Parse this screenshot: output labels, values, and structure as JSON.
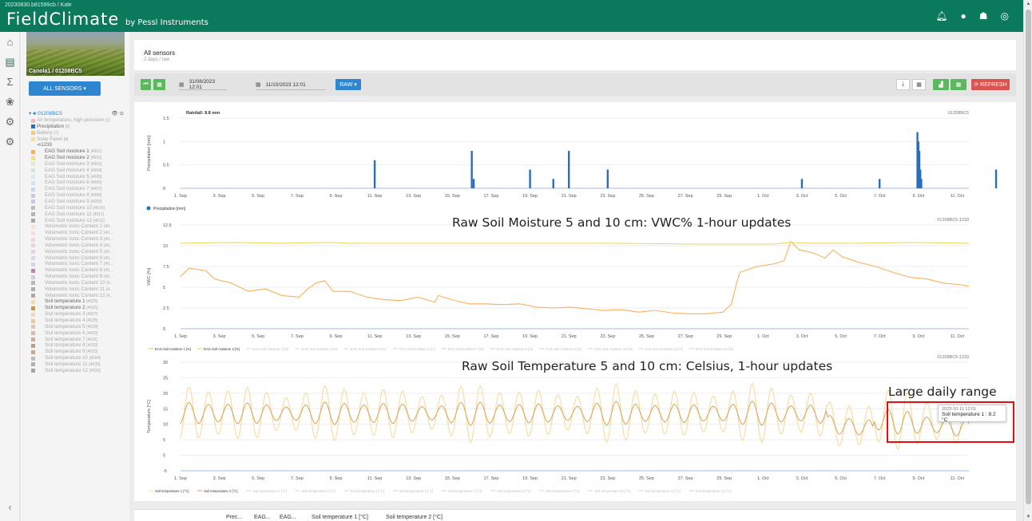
{
  "topbar": {
    "station_id": "20230830.b81599cb / Kale",
    "brand": "FieldClimate",
    "brand_suffix": "by Pessl Instruments",
    "icons": [
      "bell-icon",
      "user-icon",
      "farm-icon",
      "wifi-icon"
    ]
  },
  "rail": {
    "icons": [
      "home-icon",
      "chart-icon",
      "sum-icon",
      "plant-icon",
      "machine-icon",
      "settings-icon"
    ],
    "collapse": "‹"
  },
  "sidebar": {
    "station_label": "Canola1 / 01208BC5",
    "all_sensors_button": "ALL SENSORS ▾",
    "tree_root": "01208BC5",
    "items": [
      {
        "label": "Air temperature, high precision",
        "count": "[1]",
        "color": "#f4b6b6",
        "level": "sub",
        "dim": true
      },
      {
        "label": "Precipitation",
        "count": "[6]",
        "color": "#2a6ebb",
        "level": "sub",
        "dim": false
      },
      {
        "label": "Battery",
        "count": "[7]",
        "color": "#f4c98a",
        "level": "sub",
        "dim": true
      },
      {
        "label": "Solar Panel",
        "count": "[4]",
        "color": "#f6dca5",
        "level": "sub",
        "dim": true
      },
      {
        "label": "1233",
        "count": "",
        "color": "",
        "level": "sub",
        "dim": false,
        "prefix": "⊲"
      },
      {
        "label": "EAG Soil moisture 1",
        "count": "[4001]",
        "color": "#f7b15e",
        "level": "deep",
        "dim": false
      },
      {
        "label": "EAG Soil moisture 2",
        "count": "[4002]",
        "color": "#f3e07a",
        "level": "deep",
        "dim": false
      },
      {
        "label": "EAG Soil moisture 3",
        "count": "[4003]",
        "color": "#dcefc8",
        "level": "deep",
        "dim": true
      },
      {
        "label": "EAG Soil moisture 4",
        "count": "[4004]",
        "color": "#cfe9cf",
        "level": "deep",
        "dim": true
      },
      {
        "label": "EAG Soil moisture 5",
        "count": "[4005]",
        "color": "#d4ece9",
        "level": "deep",
        "dim": true
      },
      {
        "label": "EAG Soil moisture 6",
        "count": "[4006]",
        "color": "#cfe3f2",
        "level": "deep",
        "dim": true
      },
      {
        "label": "EAG Soil moisture 7",
        "count": "[4007]",
        "color": "#c5d8ef",
        "level": "deep",
        "dim": true
      },
      {
        "label": "EAG Soil moisture 8",
        "count": "[4008]",
        "color": "#bccbe8",
        "level": "deep",
        "dim": true
      },
      {
        "label": "EAG Soil moisture 9",
        "count": "[4009]",
        "color": "#c7c7e6",
        "level": "deep",
        "dim": true
      },
      {
        "label": "EAG Soil moisture 10",
        "count": "[4010]",
        "color": "#bdbdbd",
        "level": "deep",
        "dim": true
      },
      {
        "label": "EAG Soil moisture 11",
        "count": "[4011]",
        "color": "#b5b5b5",
        "level": "deep",
        "dim": true
      },
      {
        "label": "EAG Soil moisture 12",
        "count": "[4012]",
        "color": "#aaaaaa",
        "level": "deep",
        "dim": true
      },
      {
        "label": "Volumetric Ionic Content 1",
        "count": "[40...",
        "color": "#f4e4da",
        "level": "deep",
        "dim": true
      },
      {
        "label": "Volumetric Ionic Content 2",
        "count": "[40...",
        "color": "#f7dede",
        "level": "deep",
        "dim": true
      },
      {
        "label": "Volumetric Ionic Content 3",
        "count": "[40...",
        "color": "#f8d4e2",
        "level": "deep",
        "dim": true
      },
      {
        "label": "Volumetric Ionic Content 4",
        "count": "[40...",
        "color": "#ecd0e4",
        "level": "deep",
        "dim": true
      },
      {
        "label": "Volumetric Ionic Content 5",
        "count": "[40...",
        "color": "#e3d3ea",
        "level": "deep",
        "dim": true
      },
      {
        "label": "Volumetric Ionic Content 6",
        "count": "[40...",
        "color": "#dad6ec",
        "level": "deep",
        "dim": true
      },
      {
        "label": "Volumetric Ionic Content 7",
        "count": "[40...",
        "color": "#d2d5ea",
        "level": "deep",
        "dim": true
      },
      {
        "label": "Volumetric Ionic Content 8",
        "count": "[40...",
        "color": "#c07fc0",
        "level": "deep",
        "dim": true
      },
      {
        "label": "Volumetric Ionic Content 9",
        "count": "[40...",
        "color": "#cfcfe0",
        "level": "deep",
        "dim": true
      },
      {
        "label": "Volumetric Ionic Content 10",
        "count": "[4...",
        "color": "#b8b8b8",
        "level": "deep",
        "dim": true
      },
      {
        "label": "Volumetric Ionic Content 11",
        "count": "[4...",
        "color": "#b0b0b0",
        "level": "deep",
        "dim": true
      },
      {
        "label": "Volumetric Ionic Content 12",
        "count": "[4...",
        "color": "#a8a8a8",
        "level": "deep",
        "dim": true
      },
      {
        "label": "Soil temperature 1",
        "count": "[4025]",
        "color": "#f5dca0",
        "level": "deep",
        "dim": false
      },
      {
        "label": "Soil temperature 2",
        "count": "[4026]",
        "color": "#c79a4f",
        "level": "deep",
        "dim": false
      },
      {
        "label": "Soil temperature 3",
        "count": "[4027]",
        "color": "#f4d4c0",
        "level": "deep",
        "dim": true
      },
      {
        "label": "Soil temperature 4",
        "count": "[4028]",
        "color": "#ecc8a2",
        "level": "deep",
        "dim": true
      },
      {
        "label": "Soil temperature 5",
        "count": "[4029]",
        "color": "#e8c3a8",
        "level": "deep",
        "dim": true
      },
      {
        "label": "Soil temperature 6",
        "count": "[4030]",
        "color": "#dfb99f",
        "level": "deep",
        "dim": true
      },
      {
        "label": "Soil temperature 7",
        "count": "[4031]",
        "color": "#d7a98d",
        "level": "deep",
        "dim": true
      },
      {
        "label": "Soil temperature 8",
        "count": "[4032]",
        "color": "#c89b80",
        "level": "deep",
        "dim": true
      },
      {
        "label": "Soil temperature 9",
        "count": "[4033]",
        "color": "#c9a98c",
        "level": "deep",
        "dim": true
      },
      {
        "label": "Soil temperature 10",
        "count": "[4034]",
        "color": "#bdbdbd",
        "level": "deep",
        "dim": true
      },
      {
        "label": "Soil temperature 11",
        "count": "[4035]",
        "color": "#b0b0b0",
        "level": "deep",
        "dim": true
      },
      {
        "label": "Soil temperature 12",
        "count": "[4036]",
        "color": "#a6a6a6",
        "level": "deep",
        "dim": true
      }
    ]
  },
  "header": {
    "title": "All sensors",
    "subtitle": "2 days / raw"
  },
  "toolbar": {
    "date_from": "31/08/2023 12:01",
    "date_to": "11/10/2023 12:01",
    "raw_button": "RAW ▾",
    "refresh_button": "⟳ REFRESH"
  },
  "annotations": {
    "moisture": "Raw Soil Moisture 5 and 10 cm: VWC% 1-hour updates",
    "temperature": "Raw Soil Temperature 5 and 10 cm: Celsius, 1-hour updates",
    "range": "Large daily range"
  },
  "tooltip": {
    "date": "2023-10-11 12:01",
    "value": "Soil temperature 1 : 8.2 °C"
  },
  "bottom_table": {
    "headers": [
      "Prec...",
      "EAG...",
      "EAG...",
      "Soil temperature 1 [°C]",
      "Soil temperature 2 [°C]"
    ]
  },
  "chart_data": [
    {
      "type": "bar",
      "title": "Rainfall: 8.8 mm",
      "station_label": "01208BC5",
      "ylabel": "Precipitation [mm]",
      "ylim": [
        0,
        1.5
      ],
      "yticks": [
        0,
        0.5,
        1,
        1.5
      ],
      "xticks": [
        "1. Sep",
        "3. Sep",
        "5. Sep",
        "7. Sep",
        "9. Sep",
        "11. Sep",
        "13. Sep",
        "15. Sep",
        "17. Sep",
        "19. Sep",
        "21. Sep",
        "23. Sep",
        "25. Sep",
        "27. Sep",
        "29. Sep",
        "1. Oct",
        "3. Oct",
        "5. Oct",
        "7. Oct",
        "9. Oct",
        "11. Oct"
      ],
      "x_days_range": [
        0,
        40.6
      ],
      "color": "#2a6ebb",
      "legend": [
        "Precipitation [mm]"
      ],
      "bars": [
        {
          "day": 10.0,
          "value": 0.6
        },
        {
          "day": 15.0,
          "value": 0.8
        },
        {
          "day": 15.1,
          "value": 0.2
        },
        {
          "day": 18.0,
          "value": 0.4
        },
        {
          "day": 19.2,
          "value": 0.2
        },
        {
          "day": 20.0,
          "value": 0.8
        },
        {
          "day": 22.0,
          "value": 0.4
        },
        {
          "day": 32.0,
          "value": 0.2
        },
        {
          "day": 36.0,
          "value": 0.2
        },
        {
          "day": 37.95,
          "value": 1.2
        },
        {
          "day": 38.0,
          "value": 1.0
        },
        {
          "day": 38.05,
          "value": 0.8
        },
        {
          "day": 38.1,
          "value": 0.4
        },
        {
          "day": 38.15,
          "value": 0.2
        },
        {
          "day": 42.0,
          "value": 0.4
        }
      ]
    },
    {
      "type": "line",
      "station_label": "01208BC5:1233",
      "ylabel": "VWC [%]",
      "ylim": [
        0,
        12.5
      ],
      "yticks": [
        0,
        2.5,
        5,
        7.5,
        10,
        12.5
      ],
      "xticks": [
        "1. Sep",
        "3. Sep",
        "5. Sep",
        "7. Sep",
        "9. Sep",
        "11. Sep",
        "13. Sep",
        "15. Sep",
        "17. Sep",
        "19. Sep",
        "21. Sep",
        "23. Sep",
        "25. Sep",
        "27. Sep",
        "29. Sep",
        "1. Oct",
        "3. Oct",
        "5. Oct",
        "7. Oct",
        "9. Oct",
        "11. Oct"
      ],
      "legend": [
        "EAG Soil moisture 1 [%]",
        "EAG Soil moisture 2 [%]",
        "EAG Soil moisture 3 [%]",
        "EAG Soil moisture 4 [%]",
        "EAG Soil moisture 5 [%]",
        "EAG Soil moisture 6 [%]",
        "EAG Soil moisture 7 [%]",
        "EAG Soil moisture 8 [%]",
        "EAG Soil moisture 9 [%]",
        "EAG Soil moisture 10 [%]",
        "EAG Soil moisture 11 [%]",
        "EAG Soil moisture 12 [%]"
      ],
      "series": [
        {
          "name": "EAG Soil moisture 1 [%]",
          "color": "#f7b15e",
          "points": [
            [
              0,
              6.3
            ],
            [
              0.5,
              7.3
            ],
            [
              1.5,
              7.0
            ],
            [
              2,
              6.0
            ],
            [
              3,
              5.5
            ],
            [
              4,
              4.5
            ],
            [
              5,
              4.8
            ],
            [
              6,
              4.0
            ],
            [
              7,
              3.8
            ],
            [
              7.5,
              4.8
            ],
            [
              8,
              5.5
            ],
            [
              8.5,
              5.8
            ],
            [
              9,
              4.5
            ],
            [
              10,
              4.5
            ],
            [
              11,
              3.8
            ],
            [
              12,
              3.5
            ],
            [
              13,
              3.4
            ],
            [
              14,
              3.8
            ],
            [
              15,
              3.2
            ],
            [
              15.2,
              4.0
            ],
            [
              16,
              3.5
            ],
            [
              17,
              3.0
            ],
            [
              18,
              3.0
            ],
            [
              19,
              2.9
            ],
            [
              20,
              3.0
            ],
            [
              21,
              2.6
            ],
            [
              22,
              2.5
            ],
            [
              23,
              2.6
            ],
            [
              24,
              2.4
            ],
            [
              25,
              2.2
            ],
            [
              26,
              2.3
            ],
            [
              27,
              2.0
            ],
            [
              28,
              2.2
            ],
            [
              29,
              1.9
            ],
            [
              30,
              1.8
            ],
            [
              31,
              1.8
            ],
            [
              32,
              2.0
            ],
            [
              32.5,
              3.0
            ],
            [
              32.8,
              5.5
            ],
            [
              33,
              6.8
            ],
            [
              34,
              7.5
            ],
            [
              35,
              7.8
            ],
            [
              35.6,
              8.2
            ],
            [
              36,
              10.5
            ],
            [
              36.5,
              9.5
            ],
            [
              37,
              9.3
            ],
            [
              37.5,
              9.0
            ],
            [
              38,
              8.5
            ],
            [
              38.5,
              9.5
            ],
            [
              39,
              8.7
            ],
            [
              40,
              8.0
            ],
            [
              41,
              7.5
            ],
            [
              42,
              6.8
            ],
            [
              43,
              6.2
            ],
            [
              44,
              6.0
            ],
            [
              45,
              5.5
            ],
            [
              46,
              5.3
            ],
            [
              46.5,
              5.1
            ]
          ]
        },
        {
          "name": "EAG Soil moisture 2 [%]",
          "color": "#e8d55a",
          "points": [
            [
              0,
              10.3
            ],
            [
              3,
              10.4
            ],
            [
              6,
              10.3
            ],
            [
              9,
              10.4
            ],
            [
              10,
              10.3
            ],
            [
              15,
              10.3
            ],
            [
              18,
              10.3
            ],
            [
              20,
              10.3
            ],
            [
              25,
              10.3
            ],
            [
              30,
              10.2
            ],
            [
              33,
              10.2
            ],
            [
              35,
              10.2
            ],
            [
              36,
              10.4
            ],
            [
              37,
              10.3
            ],
            [
              40,
              10.3
            ],
            [
              43,
              10.4
            ],
            [
              46.5,
              10.3
            ]
          ]
        }
      ]
    },
    {
      "type": "line",
      "station_label": "01208BC5:1233",
      "ylabel": "Temperature [°C]",
      "ylim": [
        -5,
        30
      ],
      "yticks": [
        -5,
        0,
        5,
        10,
        15,
        20,
        25,
        30
      ],
      "xticks": [
        "1. Sep",
        "3. Sep",
        "5. Sep",
        "7. Sep",
        "9. Sep",
        "11. Sep",
        "13. Sep",
        "15. Sep",
        "17. Sep",
        "19. Sep",
        "21. Sep",
        "23. Sep",
        "25. Sep",
        "27. Sep",
        "29. Sep",
        "1. Oct",
        "3. Oct",
        "5. Oct",
        "7. Oct",
        "9. Oct",
        "11. Oct"
      ],
      "legend": [
        "Soil temperature 1 [°C]",
        "Soil temperature 2 [°C]",
        "Soil temperature 3 [°C]",
        "Soil temperature 4 [°C]",
        "Soil temperature 5 [°C]",
        "Soil temperature 6 [°C]",
        "Soil temperature 7 [°C]",
        "Soil temperature 8 [°C]",
        "Soil temperature 9 [°C]",
        "Soil temperature 10 [°C]",
        "Soil temperature 11 [°C]",
        "Soil temperature 12 [°C]"
      ],
      "series": [
        {
          "name": "Soil temperature 1 [°C]",
          "color": "#f5dca0",
          "mean": 13.5,
          "amplitude": 8.5,
          "trend_end_mean": 10.0
        },
        {
          "name": "Soil temperature 2 [°C]",
          "color": "#d4a55a",
          "mean": 13.5,
          "amplitude": 3.5,
          "trend_end_mean": 8.5
        }
      ]
    }
  ]
}
